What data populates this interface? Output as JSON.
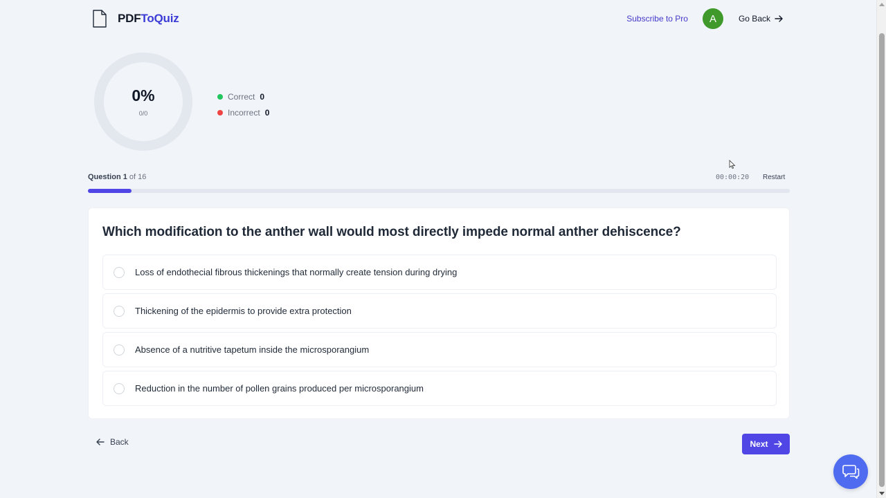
{
  "header": {
    "logo_icon": "document-icon",
    "brand_part1": "PDF",
    "brand_part2": "ToQuiz",
    "subscribe_label": "Subscribe to Pro",
    "avatar_letter": "A",
    "avatar_color": "#3f9a2b",
    "go_back_label": "Go Back"
  },
  "score": {
    "percent_label": "0%",
    "fraction_label": "0/0",
    "correct_label": "Correct",
    "correct_value": "0",
    "incorrect_label": "Incorrect",
    "incorrect_value": "0"
  },
  "progress": {
    "question_label": "Question 1",
    "of_label": "of 16",
    "timer": "00:00:20",
    "restart_label": "Restart",
    "current": 1,
    "total": 16
  },
  "question": {
    "text": "Which modification to the anther wall would most directly impede normal anther dehiscence?",
    "options": [
      "Loss of endothecial fibrous thickenings that normally create tension during drying",
      "Thickening of the epidermis to provide extra protection",
      "Absence of a nutritive tapetum inside the microsporangium",
      "Reduction in the number of pollen grains produced per microsporangium"
    ]
  },
  "nav": {
    "back_label": "Back",
    "next_label": "Next"
  },
  "colors": {
    "accent": "#4f46e5",
    "brand": "#3b3bd6",
    "correct": "#22c55e",
    "incorrect": "#ef4444"
  }
}
